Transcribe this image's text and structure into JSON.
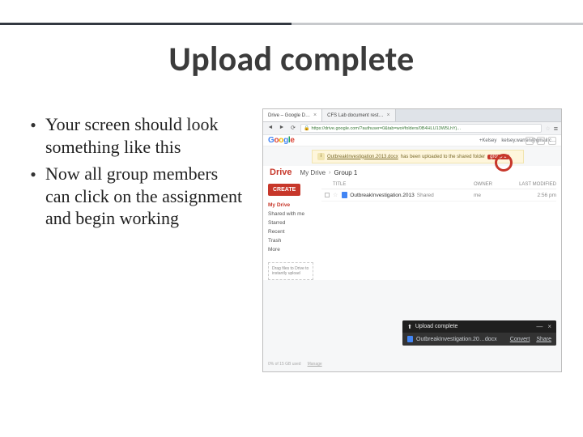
{
  "slide": {
    "title": "Upload complete",
    "bullets": [
      "Your screen should look something like this",
      "Now all group members can click on the assignment and begin working"
    ]
  },
  "browser": {
    "tab1": "Drive – Google D…",
    "tab2": "CFS Lab document rest…",
    "url": "https://drive.google.com/?authuser=0&tab=wo#folders/0B4HLU13W5LhYj…",
    "gbar_left": "+Kelsey",
    "gbar_right_email": "kelsey.warren@gmail.c…",
    "banner_file": "OutbreakInvestigation.2013.docx",
    "banner_text": "has been uploaded to the shared folder",
    "banner_group": "group 1"
  },
  "drive": {
    "brand": "Drive",
    "crumb_root": "My Drive",
    "crumb_leaf": "Group 1",
    "create": "CREATE",
    "nav": [
      "My Drive",
      "Shared with me",
      "Starred",
      "Recent",
      "Trash",
      "More"
    ],
    "upload_hint": "Drag files to Drive to instantly upload",
    "cols": {
      "title": "TITLE",
      "owner": "OWNER",
      "mod": "LAST MODIFIED"
    },
    "row": {
      "name": "OutbreakInvestigation.2013",
      "shared": "Shared",
      "owner": "me",
      "mod": "2:56 pm"
    },
    "footer1": "0% of 15 GB used",
    "footer2": "Manage"
  },
  "upload": {
    "title": "Upload complete",
    "file": "OutbreakInvestigation.20…docx",
    "link1": "Convert",
    "link2": "Share"
  }
}
